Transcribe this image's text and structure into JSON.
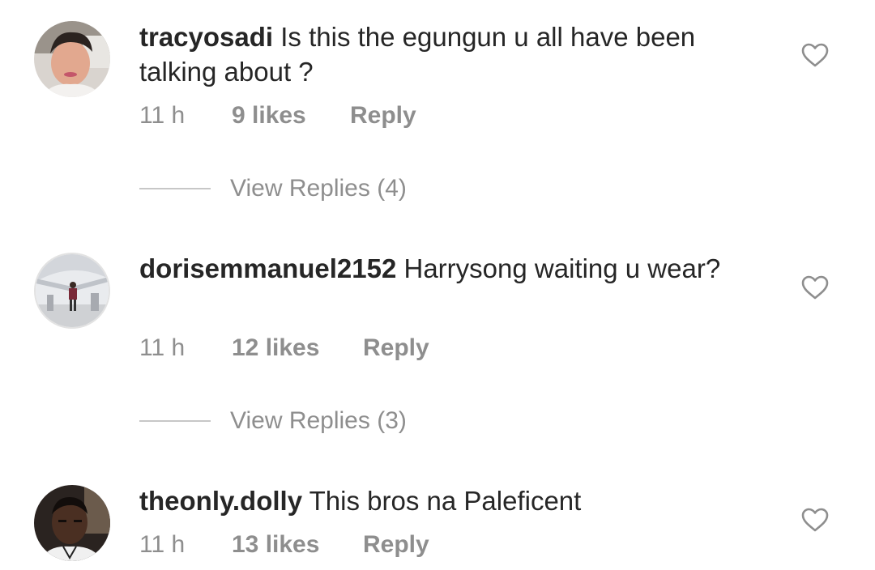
{
  "comments": [
    {
      "username": "tracyosadi",
      "text": "Is this the egungun u all have been talking about ?",
      "time": "11 h",
      "likes": "9 likes",
      "reply_label": "Reply",
      "view_replies": "View Replies (4)"
    },
    {
      "username": "dorisemmanuel2152",
      "text": "Harrysong waiting u wear?",
      "time": "11 h",
      "likes": "12 likes",
      "reply_label": "Reply",
      "view_replies": "View Replies (3)"
    },
    {
      "username": "theonly.dolly",
      "text": "This bros na Paleficent",
      "time": "11 h",
      "likes": "13 likes",
      "reply_label": "Reply"
    }
  ],
  "colors": {
    "text_primary": "#262626",
    "text_secondary": "#8e8e8e",
    "divider": "#c7c7c7"
  },
  "icons": {
    "like": "heart-outline-icon"
  }
}
